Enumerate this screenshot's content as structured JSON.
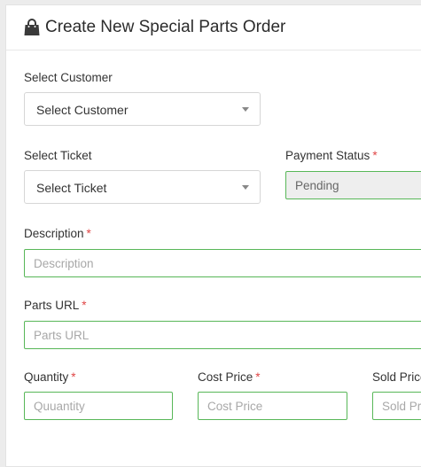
{
  "page": {
    "title": "Create New Special Parts Order"
  },
  "form": {
    "customer": {
      "label": "Select Customer",
      "value": "Select Customer"
    },
    "ticket": {
      "label": "Select Ticket",
      "value": "Select Ticket"
    },
    "payment_status": {
      "label": "Payment Status",
      "required": "*",
      "value": "Pending"
    },
    "description": {
      "label": "Description",
      "required": "*",
      "placeholder": "Description"
    },
    "parts_url": {
      "label": "Parts URL",
      "required": "*",
      "placeholder": "Parts URL"
    },
    "quantity": {
      "label": "Quantity",
      "required": "*",
      "placeholder": "Quuantity"
    },
    "cost_price": {
      "label": "Cost Price",
      "required": "*",
      "placeholder": "Cost Price"
    },
    "sold_price": {
      "label": "Sold Price",
      "placeholder": "Sold Price"
    }
  },
  "colors": {
    "valid_border": "#58b758",
    "required_star": "#e04646"
  },
  "icons": {
    "title_icon": "shopping-bag-icon",
    "select_caret": "caret-down-icon"
  }
}
